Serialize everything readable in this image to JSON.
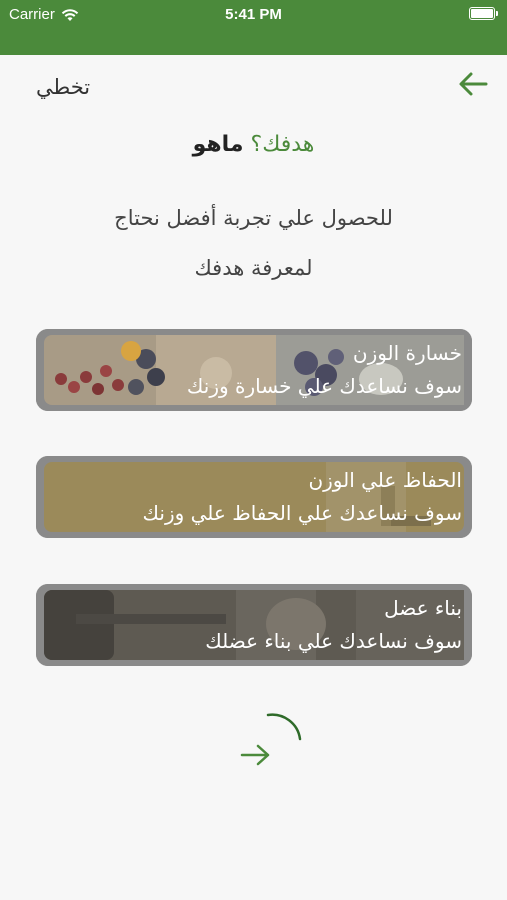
{
  "status_bar": {
    "carrier": "Carrier",
    "time": "5:41 PM"
  },
  "header": {
    "skip_label": "تخطي"
  },
  "question": {
    "accent": "هدفك؟",
    "main": "ماهو"
  },
  "intro": {
    "line1": "للحصول علي تجربة أفضل نحتاج",
    "line2": "لمعرفة هدفك"
  },
  "goals": [
    {
      "title": "خسارة الوزن",
      "subtitle": "سوف نساعدك علي خسارة وزنك"
    },
    {
      "title": "الحفاظ علي الوزن",
      "subtitle": "سوف نساعدك علي الحفاظ علي وزنك"
    },
    {
      "title": "بناء عضل",
      "subtitle": "سوف نساعدك علي بناء عضلك"
    }
  ],
  "colors": {
    "status_bar": "#4b8a3b",
    "accent": "#4b8a3b",
    "card_gray": "#8a8a8a",
    "card_gold": "#9b8a5a",
    "card_dark": "#5e5a52"
  },
  "icons": {
    "back": "arrow-left-icon",
    "next": "arrow-right-icon",
    "progress": "progress-arc-icon"
  }
}
